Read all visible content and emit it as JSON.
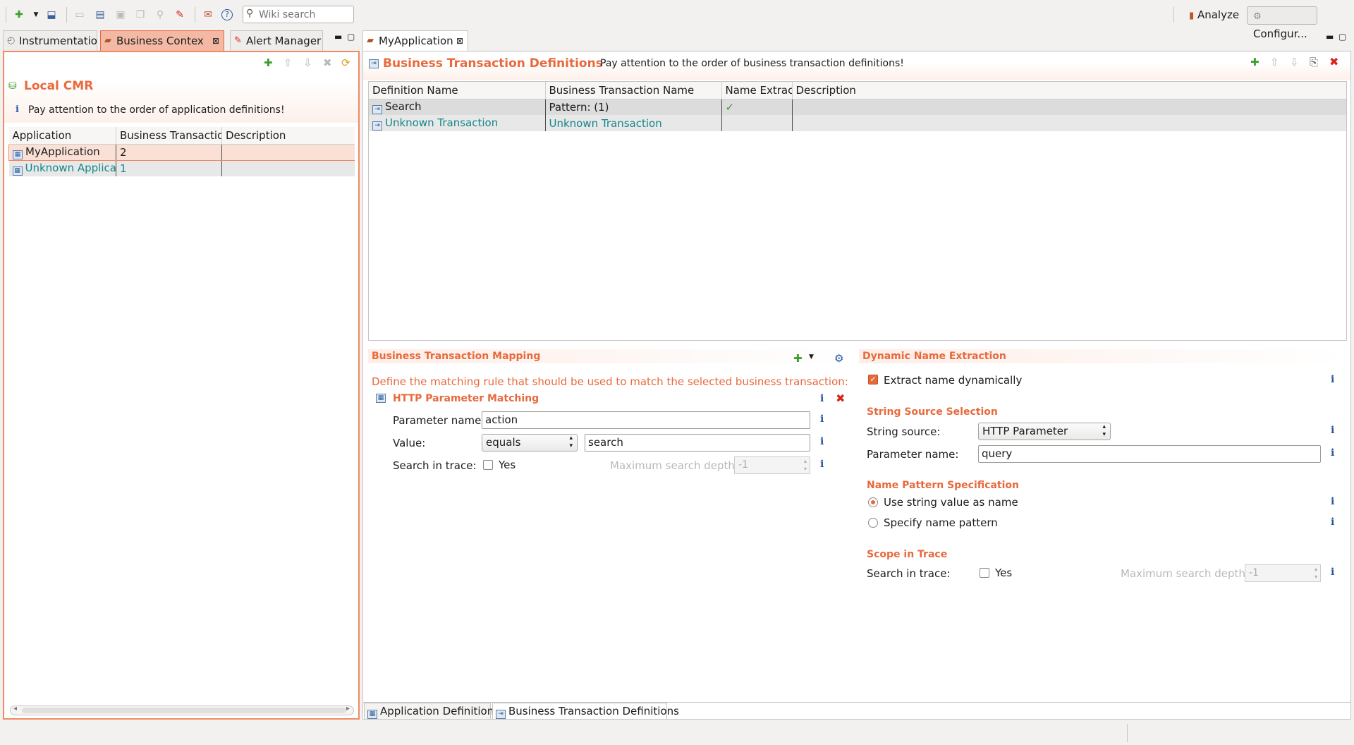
{
  "toolbar": {
    "search_placeholder": "Wiki search",
    "analyze_label": "Analyze",
    "configure_label": "Configur..."
  },
  "left_view": {
    "tabs": [
      {
        "label": "Instrumentatio"
      },
      {
        "label": "Business Contex"
      },
      {
        "label": "Alert Manager"
      }
    ],
    "title": "Local CMR",
    "info_text": "Pay attention to the order of application definitions!",
    "table": {
      "columns": [
        "Application",
        "Business Transactior",
        "Description"
      ],
      "rows": [
        {
          "application": "MyApplication",
          "count": "2",
          "description": ""
        },
        {
          "application": "Unknown Applicati",
          "count": "1",
          "description": ""
        }
      ]
    }
  },
  "editor": {
    "tab_label": "MyApplication",
    "title": "Business Transaction Definitions",
    "subtitle": "Pay attention to the order of business transaction definitions!",
    "table": {
      "columns": [
        "Definition Name",
        "Business Transaction Name",
        "Name Extracl",
        "Description"
      ],
      "rows": [
        {
          "definition": "Search",
          "bt_name": "Pattern: (1)",
          "extract": "✓",
          "description": ""
        },
        {
          "definition": "Unknown Transaction",
          "bt_name": "Unknown Transaction",
          "extract": "",
          "description": ""
        }
      ]
    },
    "mapping": {
      "title": "Business Transaction Mapping",
      "rule_text": "Define the matching rule that should be used to match the selected business transaction:",
      "rule_title": "HTTP Parameter Matching",
      "param_name_label": "Parameter name:",
      "param_name_value": "action",
      "value_label": "Value:",
      "operator": "equals",
      "value_value": "search",
      "search_in_trace_label": "Search in trace:",
      "yes_label": "Yes",
      "max_depth_label": "Maximum search depth:",
      "max_depth_value": "-1"
    },
    "dynamic": {
      "title": "Dynamic Name Extraction",
      "extract_label": "Extract name dynamically",
      "source_title": "String Source Selection",
      "string_source_label": "String source:",
      "string_source_value": "HTTP Parameter",
      "param_name_label": "Parameter name:",
      "param_name_value": "query",
      "pattern_title": "Name Pattern Specification",
      "option_use_string": "Use string value as name",
      "option_specify": "Specify name pattern",
      "scope_title": "Scope in Trace",
      "search_in_trace_label": "Search in trace:",
      "yes_label": "Yes",
      "max_depth_label": "Maximum search depth:",
      "max_depth_value": "-1"
    },
    "bottom_tabs": [
      {
        "label": "Application Definition"
      },
      {
        "label": "Business Transaction Definitions"
      }
    ]
  },
  "colors": {
    "accent": "#e8693c",
    "teal": "#13878a",
    "info": "#2556a0",
    "delete": "#d9231c"
  }
}
